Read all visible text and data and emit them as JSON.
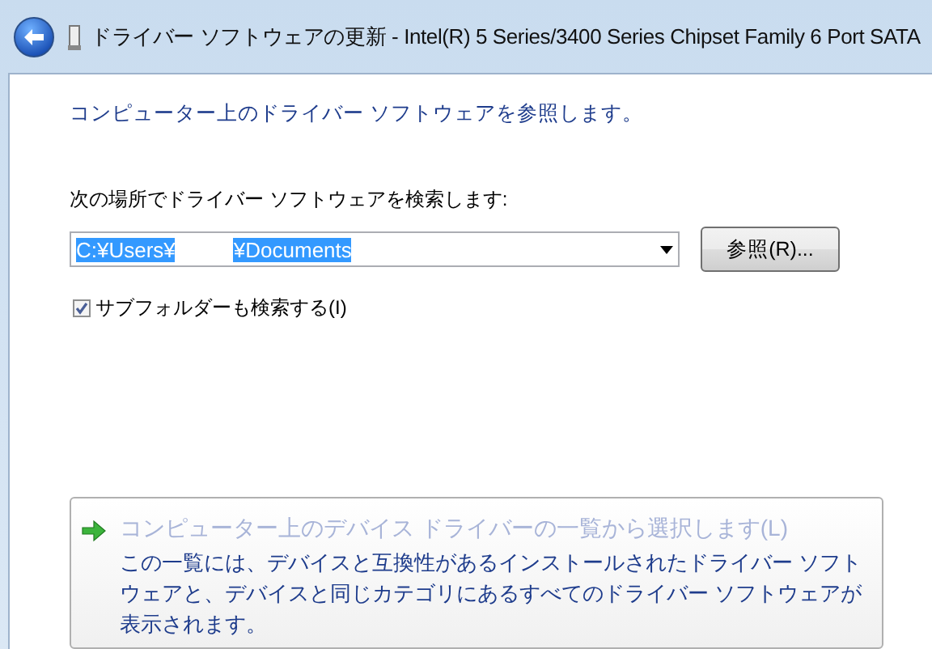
{
  "window": {
    "title": "ドライバー ソフトウェアの更新 - Intel(R) 5 Series/3400 Series Chipset Family 6 Port SATA"
  },
  "heading": "コンピューター上のドライバー ソフトウェアを参照します。",
  "search": {
    "label": "次の場所でドライバー ソフトウェアを検索します:",
    "path_parts": [
      "C:¥Users¥",
      "¥Documents"
    ],
    "selected": true,
    "browse_button": "参照(R)..."
  },
  "subfolders": {
    "label": "サブフォルダーも検索する(I)",
    "checked": true
  },
  "command_link": {
    "title": "コンピューター上のデバイス ドライバーの一覧から選択します(L)",
    "description": "この一覧には、デバイスと互換性があるインストールされたドライバー ソフトウェアと、デバイスと同じカテゴリにあるすべてのドライバー ソフトウェアが表示されます。",
    "disabled": true
  }
}
